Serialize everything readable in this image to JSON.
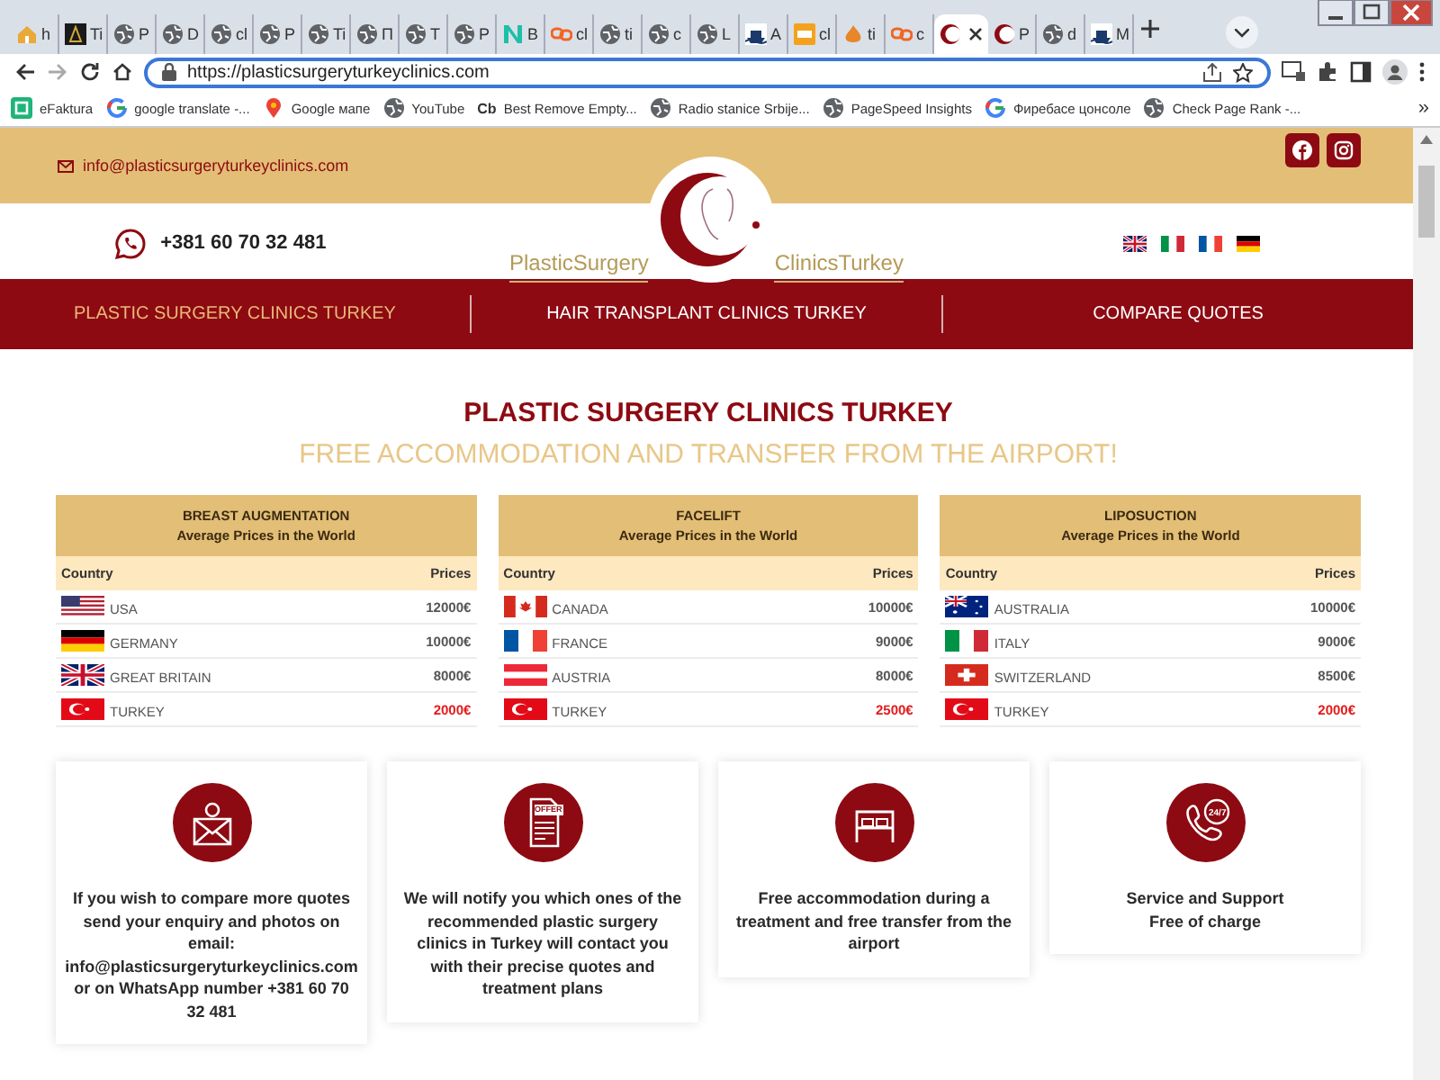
{
  "browser": {
    "tabs": [
      {
        "label": "h",
        "kind": "home",
        "selected": false
      },
      {
        "label": "Ti",
        "kind": "dark",
        "selected": false
      },
      {
        "label": "P",
        "kind": "globe",
        "selected": false
      },
      {
        "label": "D",
        "kind": "globe",
        "selected": false
      },
      {
        "label": "cl",
        "kind": "globe",
        "selected": false
      },
      {
        "label": "P",
        "kind": "globe",
        "selected": false
      },
      {
        "label": "Ti",
        "kind": "globe",
        "selected": false
      },
      {
        "label": "П",
        "kind": "globe",
        "selected": false
      },
      {
        "label": "T",
        "kind": "globe",
        "selected": false
      },
      {
        "label": "P",
        "kind": "globe",
        "selected": false
      },
      {
        "label": "B",
        "kind": "n",
        "selected": false
      },
      {
        "label": "cl",
        "kind": "link",
        "selected": false
      },
      {
        "label": "ti",
        "kind": "globe",
        "selected": false
      },
      {
        "label": "c",
        "kind": "globe",
        "selected": false
      },
      {
        "label": "L",
        "kind": "globe",
        "selected": false
      },
      {
        "label": "A",
        "kind": "ship",
        "selected": false
      },
      {
        "label": "cl",
        "kind": "sh",
        "selected": false
      },
      {
        "label": "ti",
        "kind": "fire",
        "selected": false
      },
      {
        "label": "c",
        "kind": "link",
        "selected": false
      },
      {
        "kind": "crescent",
        "selected": true
      },
      {
        "label": "P",
        "kind": "crescent",
        "selected": false
      },
      {
        "label": "d",
        "kind": "globe",
        "selected": false
      },
      {
        "label": "M",
        "kind": "ship",
        "selected": false
      }
    ],
    "url": "https://plasticsurgeryturkeyclinics.com",
    "bookmarks": [
      {
        "label": "eFaktura",
        "kind": "efaktura"
      },
      {
        "label": "google translate -...",
        "kind": "google"
      },
      {
        "label": "Google мапе",
        "kind": "maps"
      },
      {
        "label": "YouTube",
        "kind": "globe"
      },
      {
        "label": "Best Remove Empty...",
        "kind": "badge",
        "badge": "Cb"
      },
      {
        "label": "Radio stanice Srbije...",
        "kind": "globe"
      },
      {
        "label": "PageSpeed Insights",
        "kind": "globe"
      },
      {
        "label": "Фиребасе цонсоле",
        "kind": "google"
      },
      {
        "label": "Check Page Rank -...",
        "kind": "globe"
      }
    ],
    "more": "»"
  },
  "topbar": {
    "email": "info@plasticsurgeryturkeyclinics.com",
    "social": [
      {
        "kind": "facebook"
      },
      {
        "kind": "instagram"
      }
    ]
  },
  "header": {
    "phone": "+381 60 70 32 481",
    "logo": [
      "PlasticSurgery",
      "ClinicsTurkey"
    ],
    "languages": [
      {
        "kind": "gb"
      },
      {
        "kind": "it"
      },
      {
        "kind": "fr"
      },
      {
        "kind": "de"
      }
    ]
  },
  "nav": [
    {
      "label": "PLASTIC SURGERY CLINICS TURKEY",
      "selected": true
    },
    {
      "label": "HAIR TRANSPLANT CLINICS TURKEY",
      "selected": false
    },
    {
      "label": "COMPARE QUOTES",
      "selected": false
    }
  ],
  "title": "PLASTIC SURGERY CLINICS TURKEY",
  "subtitle": "FREE ACCOMMODATION AND TRANSFER FROM THE AIRPORT!",
  "price_tables": [
    {
      "title": "BREAST AUGMENTATION",
      "subtitle": "Average Prices in the World",
      "columns": [
        "Country",
        "Prices"
      ],
      "rows": [
        {
          "kind": "us",
          "country": "USA",
          "price": "12000€",
          "highlight": false
        },
        {
          "kind": "de",
          "country": "GERMANY",
          "price": "10000€",
          "highlight": false
        },
        {
          "kind": "gb",
          "country": "GREAT BRITAIN",
          "price": "8000€",
          "highlight": false
        },
        {
          "kind": "tr",
          "country": "TURKEY",
          "price": "2000€",
          "highlight": true
        }
      ]
    },
    {
      "title": "FACELIFT",
      "subtitle": "Average Prices in the World",
      "columns": [
        "Country",
        "Prices"
      ],
      "rows": [
        {
          "kind": "ca",
          "country": "CANADA",
          "price": "10000€",
          "highlight": false
        },
        {
          "kind": "fr",
          "country": "FRANCE",
          "price": "9000€",
          "highlight": false
        },
        {
          "kind": "at",
          "country": "AUSTRIA",
          "price": "8000€",
          "highlight": false
        },
        {
          "kind": "tr",
          "country": "TURKEY",
          "price": "2500€",
          "highlight": true
        }
      ]
    },
    {
      "title": "LIPOSUCTION",
      "subtitle": "Average Prices in the World",
      "columns": [
        "Country",
        "Prices"
      ],
      "rows": [
        {
          "kind": "au",
          "country": "AUSTRALIA",
          "price": "10000€",
          "highlight": false
        },
        {
          "kind": "it",
          "country": "ITALY",
          "price": "9000€",
          "highlight": false
        },
        {
          "kind": "ch",
          "country": "SWITZERLAND",
          "price": "8500€",
          "highlight": false
        },
        {
          "kind": "tr",
          "country": "TURKEY",
          "price": "2000€",
          "highlight": true
        }
      ]
    }
  ],
  "cards": [
    {
      "kind": "mail",
      "text": "If you wish to compare more quotes send your enquiry and photos on email: info@plasticsurgeryturkeyclinics.com or on WhatsApp number +381 60 70 32 481"
    },
    {
      "kind": "offer",
      "icon_label": "OFFER",
      "text": "We will notify you which ones of the recommended plastic surgery clinics in Turkey will contact you with their precise quotes and treatment plans"
    },
    {
      "kind": "bed",
      "text": "Free accommodation during a treatment and free transfer from the airport"
    },
    {
      "kind": "phone",
      "icon_label": "24/7",
      "text": "Service and Support\nFree of charge"
    }
  ]
}
